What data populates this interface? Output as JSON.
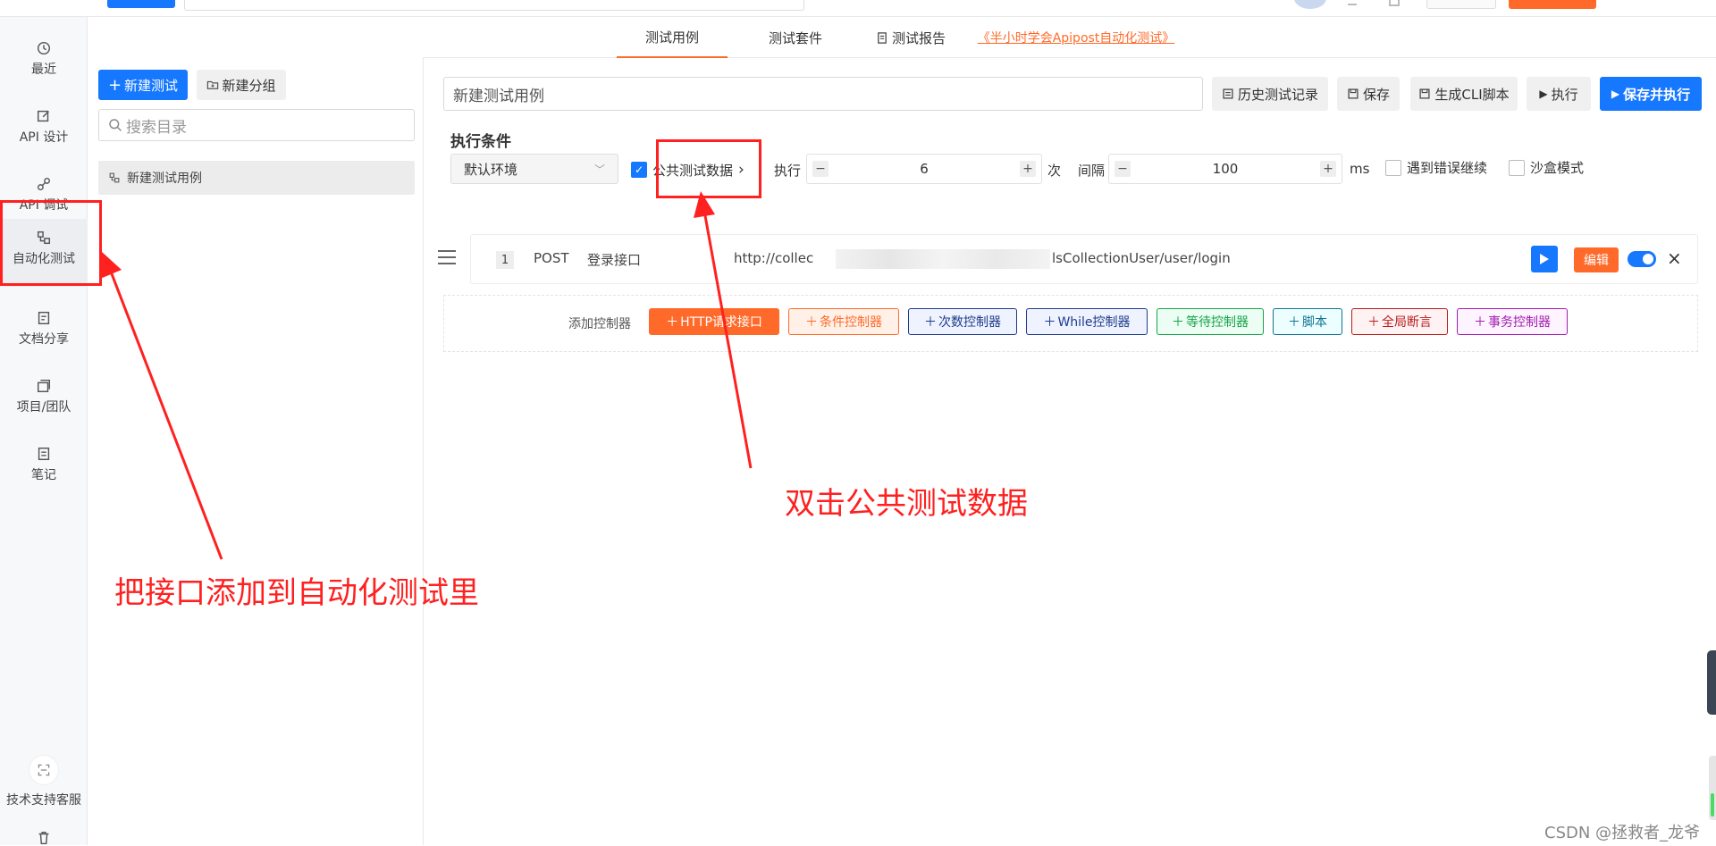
{
  "nav": {
    "items": [
      {
        "label": "最近",
        "icon": "history-icon"
      },
      {
        "label": "API 设计",
        "icon": "edit-icon"
      },
      {
        "label": "API 调试",
        "icon": "link-icon"
      },
      {
        "label": "自动化测试",
        "icon": "flow-icon"
      },
      {
        "label": "文档分享",
        "icon": "document-icon"
      },
      {
        "label": "项目/团队",
        "icon": "project-icon"
      },
      {
        "label": "笔记",
        "icon": "note-icon"
      }
    ],
    "support_label": "技术支持客服"
  },
  "tree": {
    "new_test": "新建测试",
    "new_group": "新建分组",
    "search_placeholder": "搜索目录",
    "items": [
      "新建测试用例"
    ]
  },
  "tabs": [
    {
      "label": "测试用例",
      "active": true
    },
    {
      "label": "测试套件"
    },
    {
      "label": "测试报告"
    },
    {
      "label": "《半小时学会Apipost自动化测试》",
      "link": true
    }
  ],
  "toolbar": {
    "case_name": "新建测试用例",
    "history": "历史测试记录",
    "save": "保存",
    "cli": "生成CLI脚本",
    "run": "执行",
    "save_run": "保存并执行"
  },
  "exec": {
    "title": "执行条件",
    "env": "默认环境",
    "public_data": "公共测试数据",
    "times_label": "执行",
    "times_value": "6",
    "times_unit": "次",
    "interval_label": "间隔",
    "interval_value": "100",
    "interval_unit": "ms",
    "continue_on_error": "遇到错误继续",
    "sandbox": "沙盒模式"
  },
  "step": {
    "index": "1",
    "method": "POST",
    "name": "登录接口",
    "url_start": "http://collec",
    "url_end": "lsCollectionUser/user/login",
    "edit": "编辑"
  },
  "controllers": {
    "label": "添加控制器",
    "buttons": [
      {
        "label": "HTTP请求接口",
        "color": "#ff6a2a"
      },
      {
        "label": "条件控制器",
        "color": "#ff6a2a"
      },
      {
        "label": "次数控制器",
        "color": "#1e3a8a"
      },
      {
        "label": "While控制器",
        "color": "#1e3a8a"
      },
      {
        "label": "等待控制器",
        "color": "#16a34a"
      },
      {
        "label": "脚本",
        "color": "#0e7490"
      },
      {
        "label": "全局断言",
        "color": "#b91c1c"
      },
      {
        "label": "事务控制器",
        "color": "#a21caf"
      }
    ]
  },
  "annotations": {
    "left": "把接口添加到自动化测试里",
    "right": "双击公共测试数据"
  },
  "watermark": "CSDN @拯救者_龙爷"
}
